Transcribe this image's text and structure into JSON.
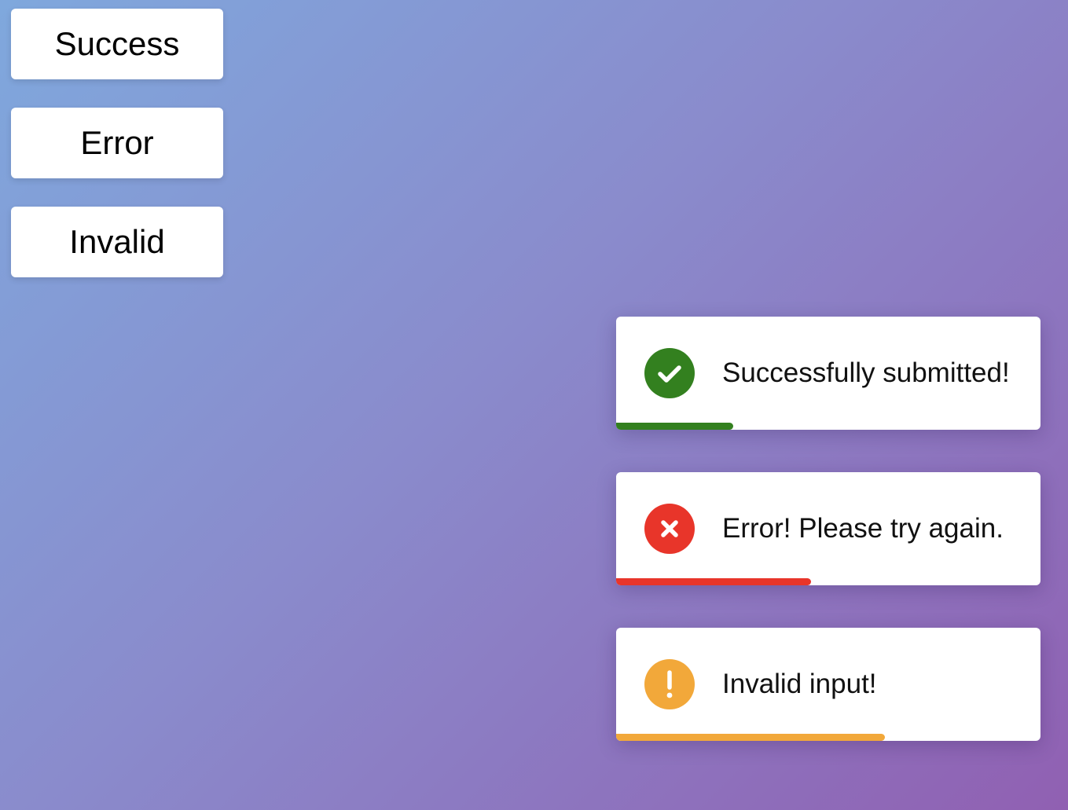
{
  "buttons": {
    "success_label": "Success",
    "error_label": "Error",
    "invalid_label": "Invalid"
  },
  "toasts": [
    {
      "type": "success",
      "icon": "check-circle-icon",
      "message": "Successfully submitted!",
      "color": "#33801f",
      "progress": 0.276
    },
    {
      "type": "error",
      "icon": "x-circle-icon",
      "message": "Error! Please try again.",
      "color": "#e8352a",
      "progress": 0.459
    },
    {
      "type": "invalid",
      "icon": "exclamation-circle-icon",
      "message": "Invalid input!",
      "color": "#f2a83a",
      "progress": 0.633
    }
  ]
}
